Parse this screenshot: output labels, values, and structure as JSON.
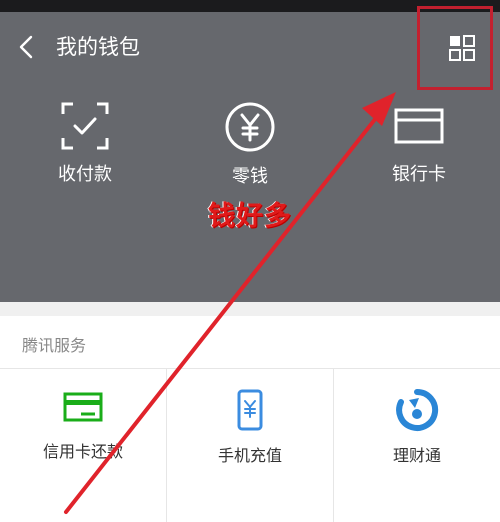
{
  "header": {
    "title": "我的钱包"
  },
  "quick_actions": [
    {
      "label": "收付款",
      "icon": "scan-pay-icon"
    },
    {
      "label": "零钱",
      "icon": "yuan-coin-icon"
    },
    {
      "label": "银行卡",
      "icon": "bank-card-icon"
    }
  ],
  "annotation": {
    "text": "钱好多",
    "color": "#e01a1a"
  },
  "services": {
    "section_title": "腾讯服务",
    "items": [
      {
        "label": "信用卡还款",
        "icon": "credit-card-icon",
        "color": "#1aad19"
      },
      {
        "label": "手机充值",
        "icon": "phone-recharge-icon",
        "color": "#3b8ce0"
      },
      {
        "label": "理财通",
        "icon": "licaitong-icon",
        "color": "#2a86d6"
      }
    ]
  },
  "colors": {
    "header_bg": "#66686d",
    "accent_red": "#c2202f"
  }
}
